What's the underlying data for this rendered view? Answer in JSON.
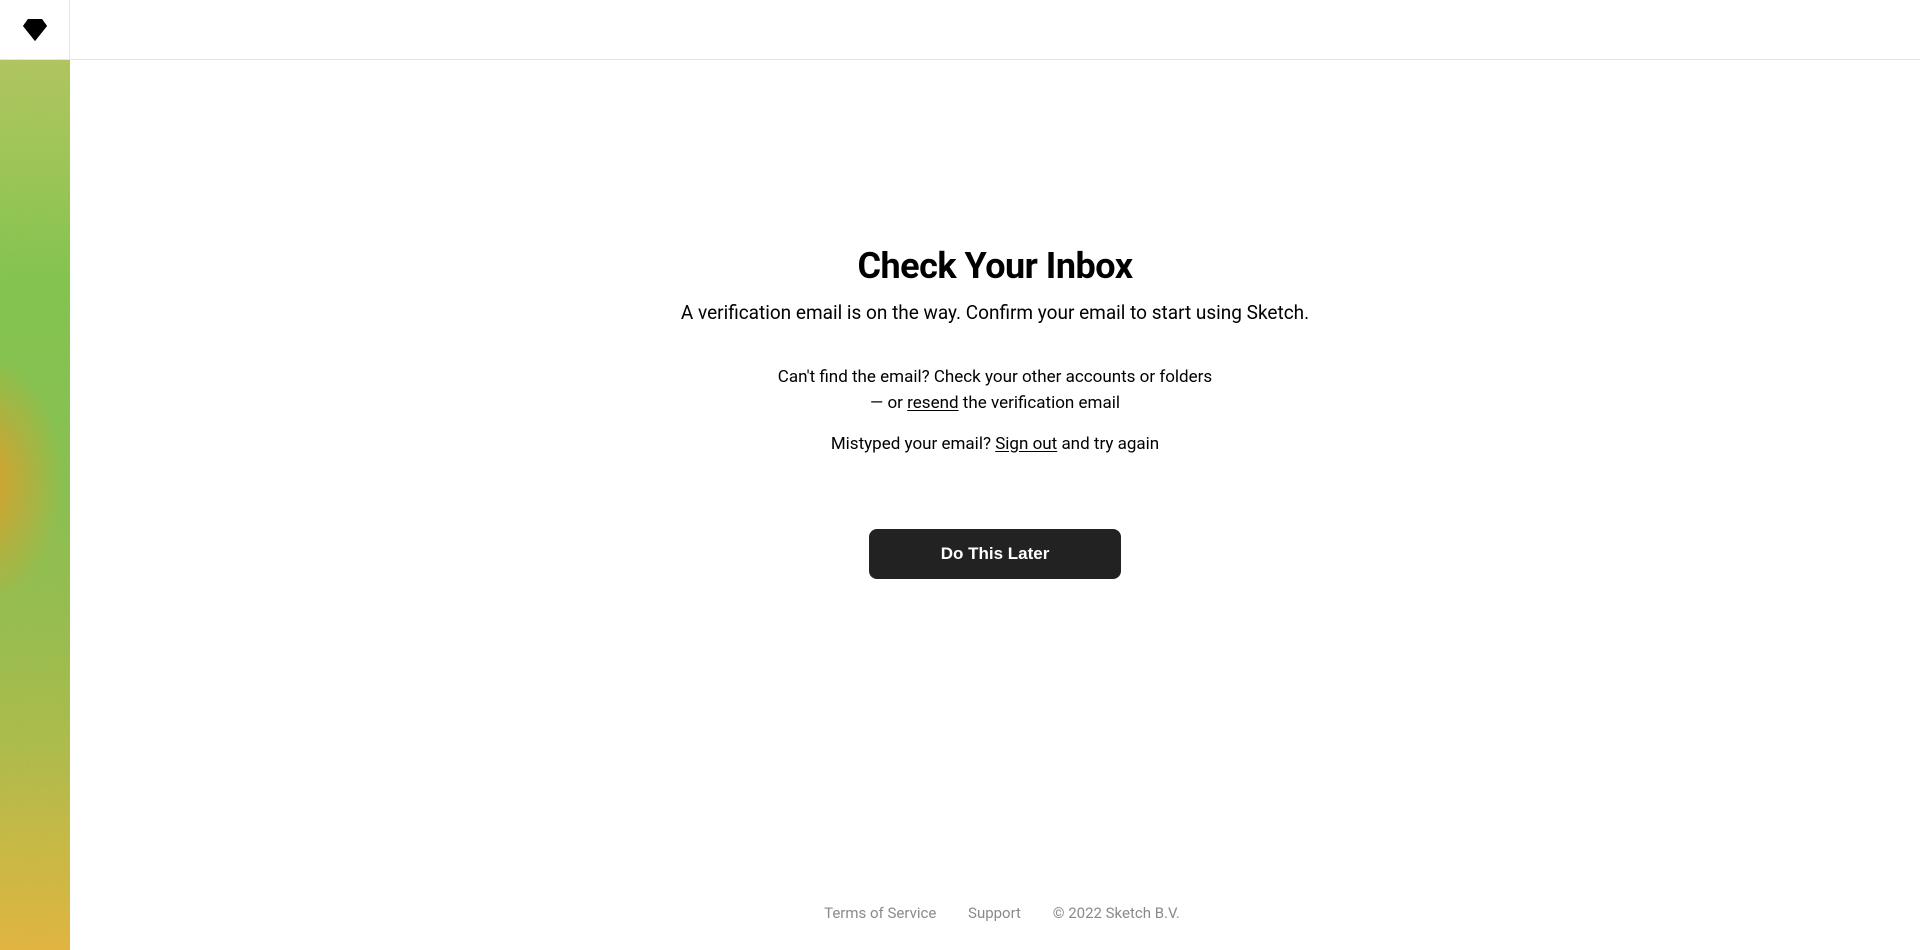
{
  "header": {
    "logo_name": "sketch-logo"
  },
  "main": {
    "title": "Check Your Inbox",
    "subtitle": "A verification email is on the way. Confirm your email to start using Sketch.",
    "help1_pre": "Can't find the email? Check your other accounts or folders",
    "help1_or": "— or ",
    "resend_link": "resend",
    "help1_post": " the verification email",
    "help2_pre": "Mistyped your email? ",
    "signout_link": "Sign out",
    "help2_post": " and try again",
    "cta_label": "Do This Later"
  },
  "footer": {
    "terms": "Terms of Service",
    "support": "Support",
    "copyright": "© 2022 Sketch B.V."
  }
}
